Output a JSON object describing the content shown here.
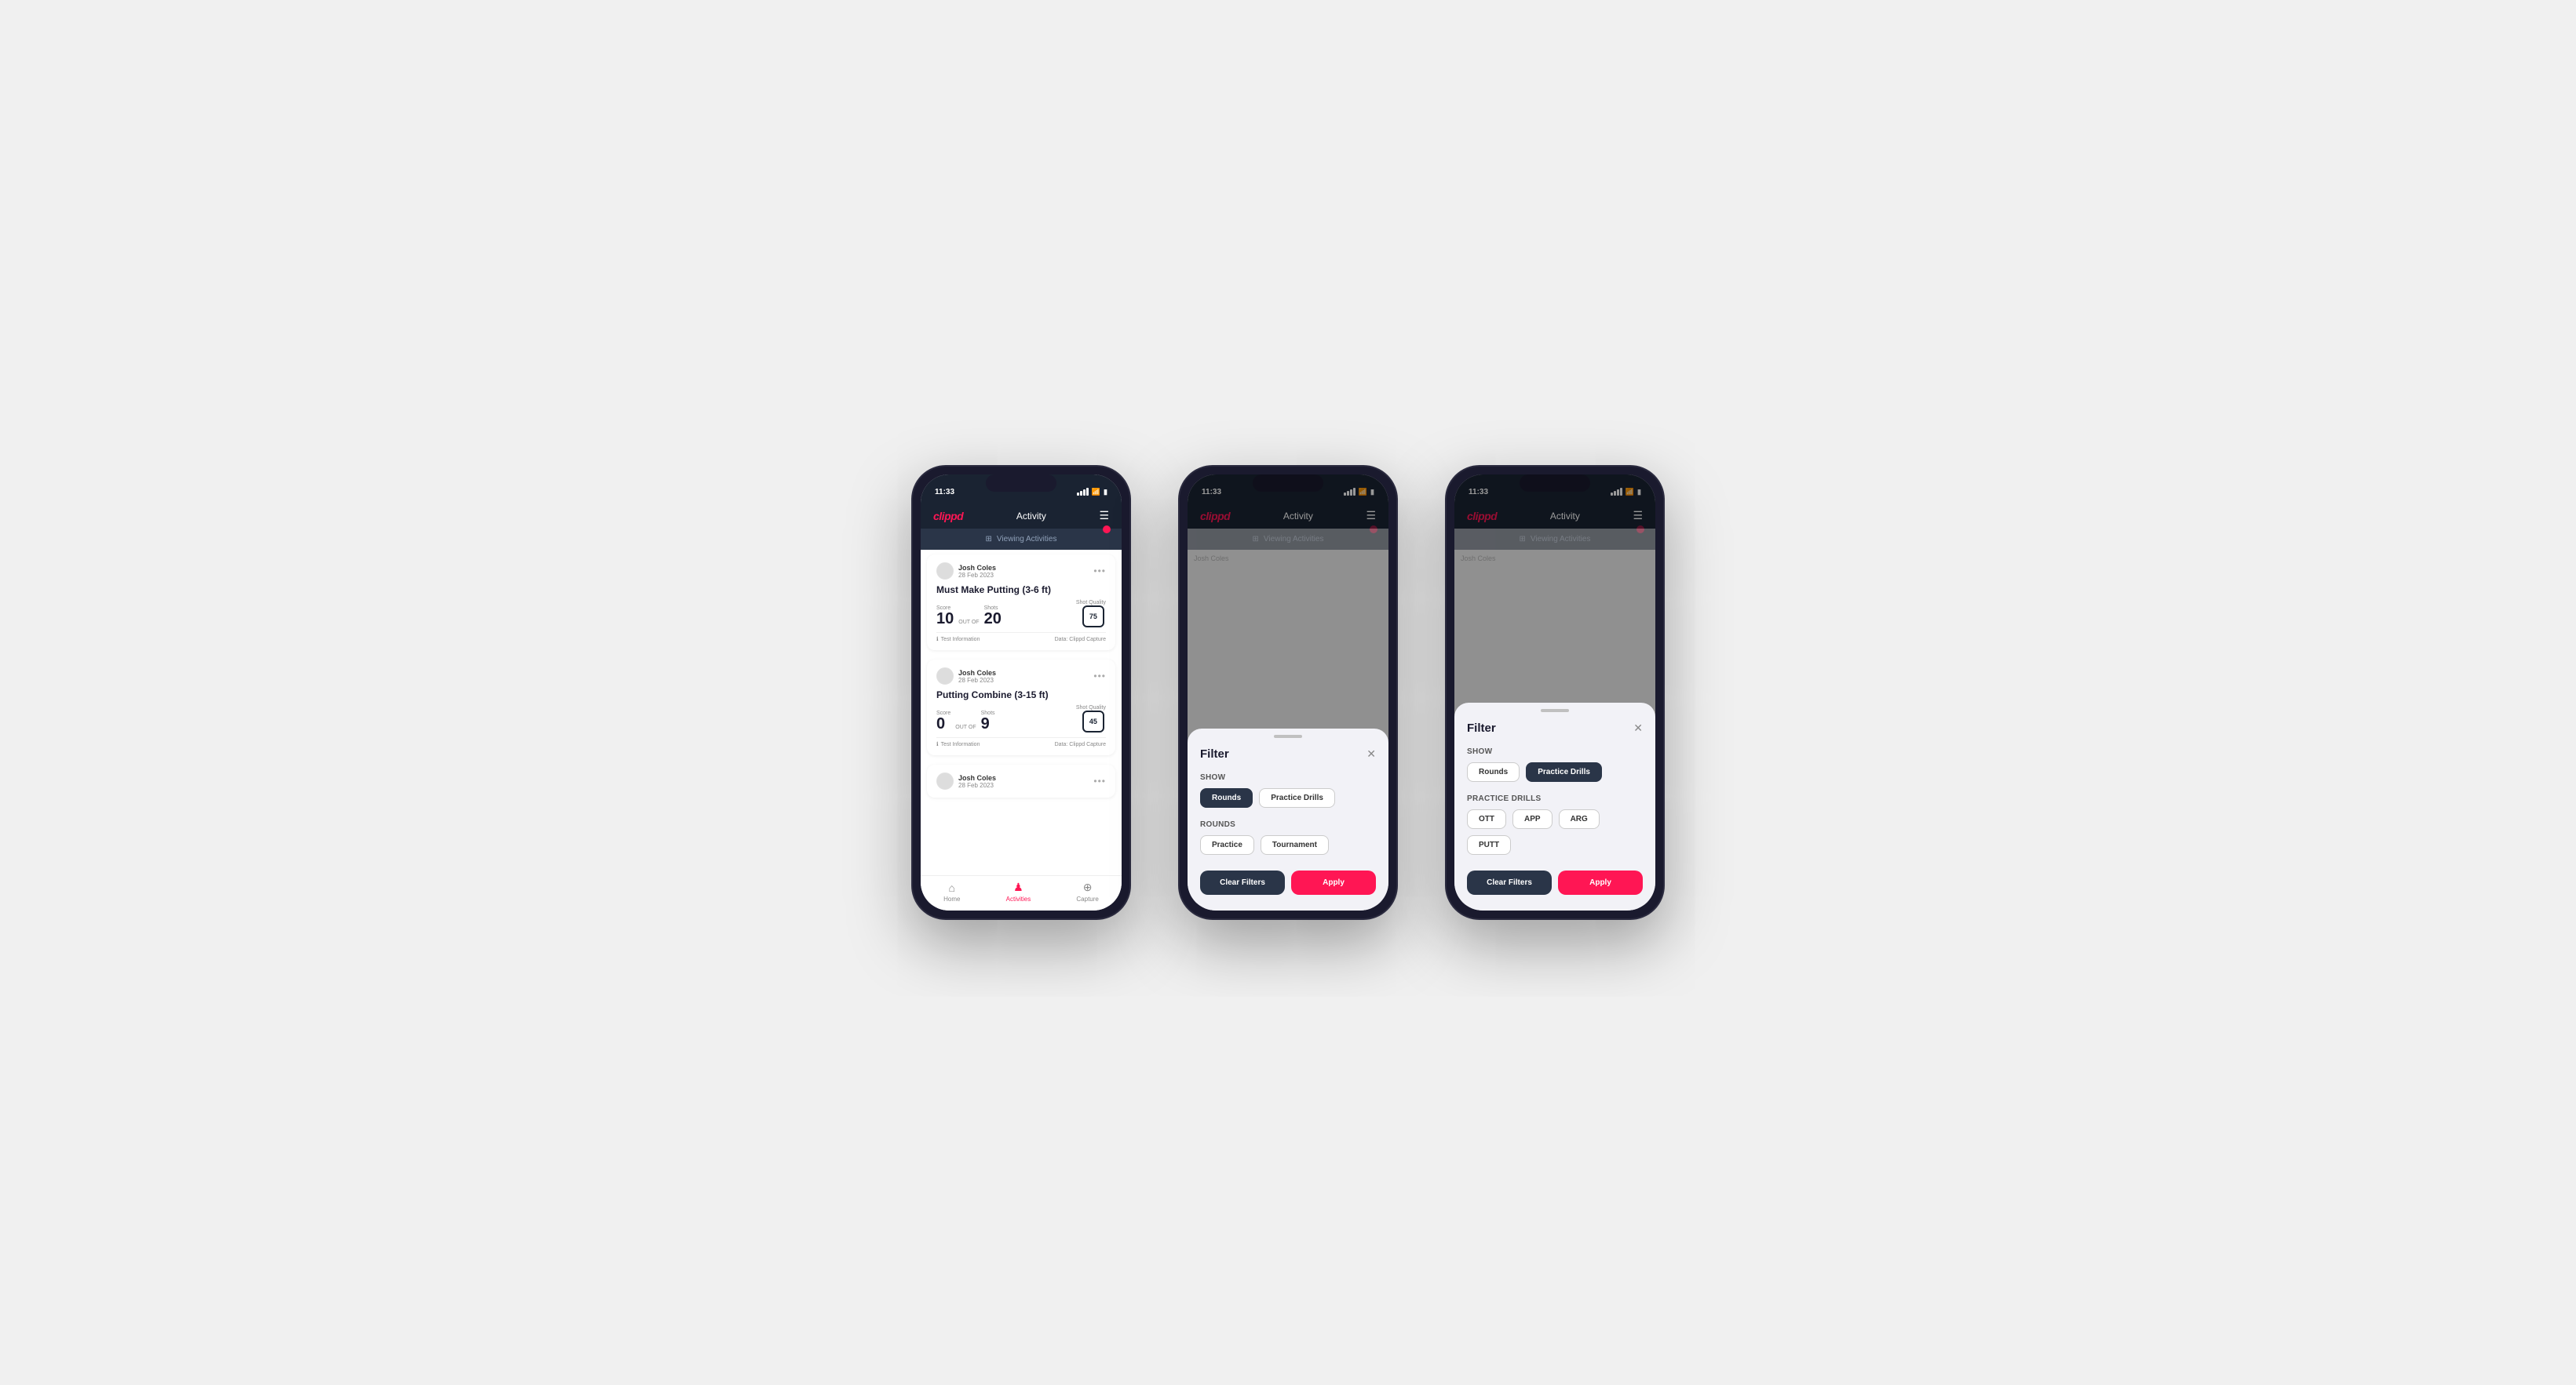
{
  "app": {
    "logo": "clippd",
    "nav_title": "Activity",
    "menu_icon": "☰",
    "status_time": "11:33"
  },
  "banner": {
    "icon": "⊞",
    "text": "Viewing Activities"
  },
  "activities": [
    {
      "user_name": "Josh Coles",
      "user_date": "28 Feb 2023",
      "title": "Must Make Putting (3-6 ft)",
      "score_label": "Score",
      "score_value": "10",
      "outof_label": "OUT OF",
      "shots_label": "Shots",
      "shots_value": "20",
      "quality_label": "Shot Quality",
      "quality_value": "75",
      "footer_left": "Test Information",
      "footer_right": "Data: Clippd Capture"
    },
    {
      "user_name": "Josh Coles",
      "user_date": "28 Feb 2023",
      "title": "Putting Combine (3-15 ft)",
      "score_label": "Score",
      "score_value": "0",
      "outof_label": "OUT OF",
      "shots_label": "Shots",
      "shots_value": "9",
      "quality_label": "Shot Quality",
      "quality_value": "45",
      "footer_left": "Test Information",
      "footer_right": "Data: Clippd Capture"
    },
    {
      "user_name": "Josh Coles",
      "user_date": "28 Feb 2023",
      "title": "",
      "score_label": "",
      "score_value": "",
      "outof_label": "",
      "shots_label": "",
      "shots_value": "",
      "quality_label": "",
      "quality_value": "",
      "footer_left": "",
      "footer_right": ""
    }
  ],
  "bottom_nav": [
    {
      "label": "Home",
      "icon": "⌂",
      "active": false
    },
    {
      "label": "Activities",
      "icon": "♟",
      "active": true
    },
    {
      "label": "Capture",
      "icon": "⊕",
      "active": false
    }
  ],
  "filter_modal": {
    "title": "Filter",
    "show_label": "Show",
    "rounds_label": "Rounds",
    "practice_drills_label": "Practice Drills",
    "rounds_chips_label": "Rounds",
    "rounds_types": [
      "Practice",
      "Tournament"
    ],
    "drills_chips_label": "Practice Drills",
    "drills_types": [
      "OTT",
      "APP",
      "ARG",
      "PUTT"
    ],
    "clear_label": "Clear Filters",
    "apply_label": "Apply"
  },
  "phone2": {
    "active_show": "Rounds",
    "active_rounds": []
  },
  "phone3": {
    "active_show": "Practice Drills",
    "active_drills": []
  }
}
